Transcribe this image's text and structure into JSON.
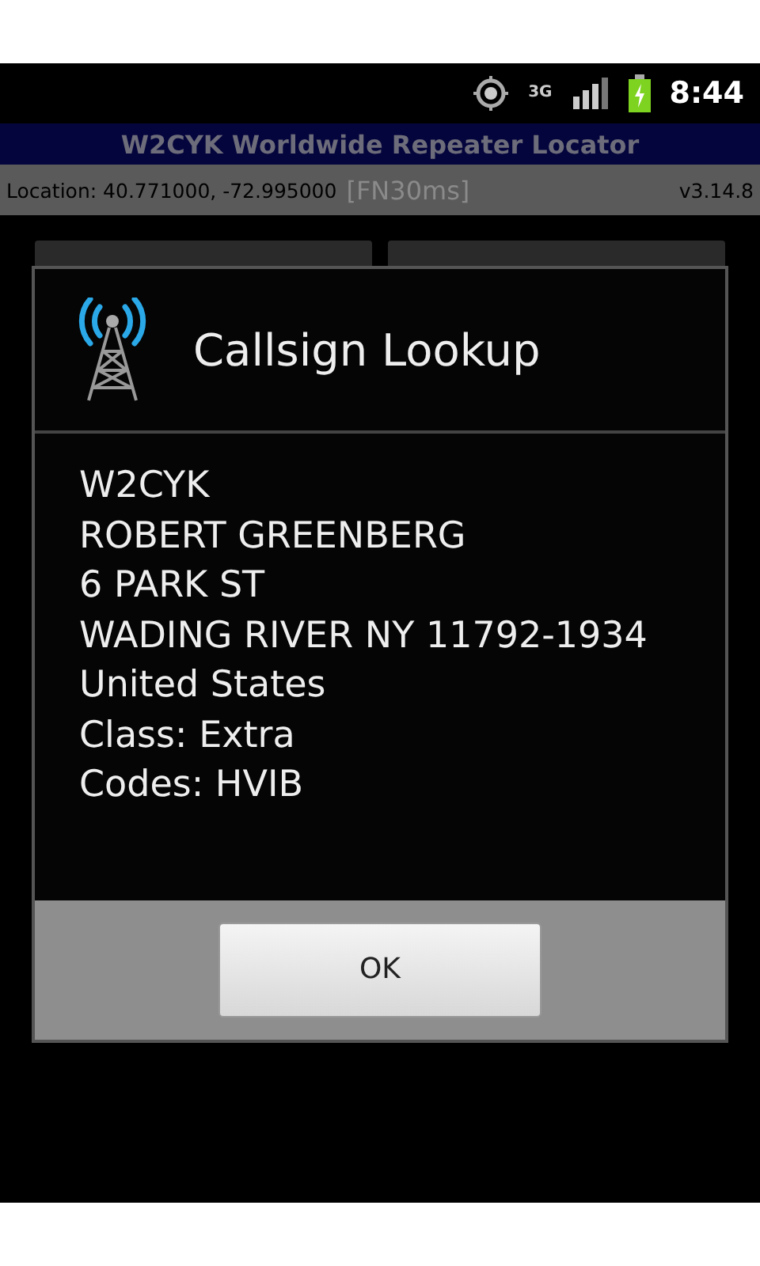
{
  "status_bar": {
    "time": "8:44",
    "network": "3G"
  },
  "app": {
    "title": "W2CYK Worldwide Repeater Locator",
    "location": "Location: 40.771000, -72.995000",
    "grid": "[FN30ms]",
    "version": "v3.14.8"
  },
  "dialog": {
    "title": "Callsign Lookup",
    "lines": [
      "W2CYK",
      "ROBERT GREENBERG",
      "6 PARK ST",
      "WADING RIVER NY 11792-1934",
      "United States",
      "Class: Extra",
      "Codes: HVIB"
    ],
    "buttons": [
      "OK"
    ]
  }
}
